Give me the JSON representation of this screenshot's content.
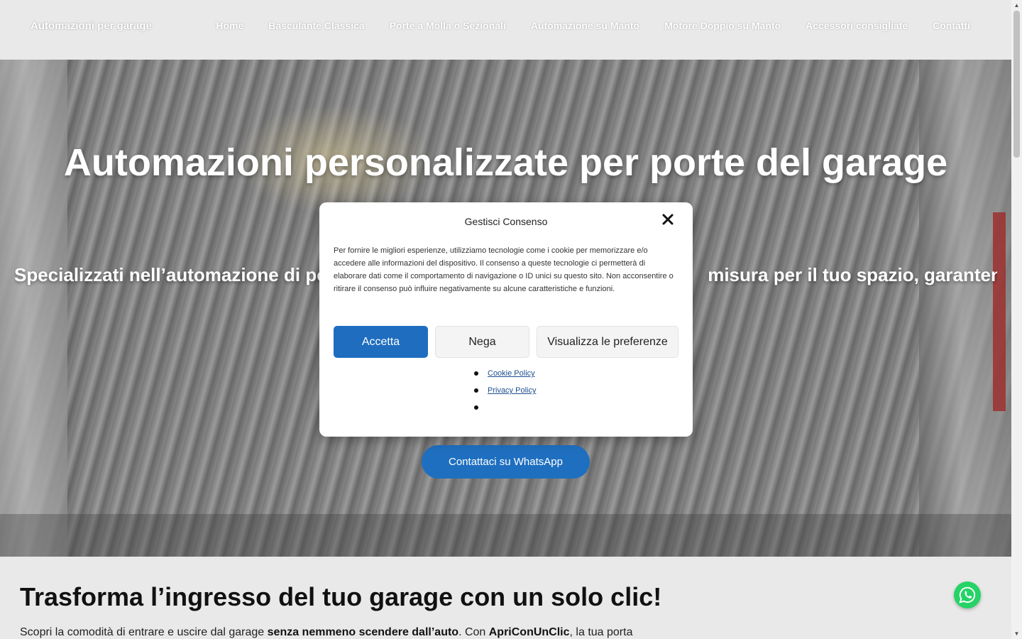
{
  "header": {
    "brand": "Automazioni per garage",
    "nav": [
      "Home",
      "Basculante Classica",
      "Porte a Molla o Sezionali",
      "Automazione su Manto",
      "Motore Doppio su Manto",
      "Accessori consigliate",
      "Contatti"
    ]
  },
  "hero": {
    "title": "Automazioni personalizzate per porte del garage",
    "subtitle_left": "Specializzati nell’automazione di por",
    "subtitle_right": "misura per il tuo spazio, garantendo",
    "cta_label": "Contattaci su WhatsApp"
  },
  "section": {
    "title": "Trasforma l’ingresso del tuo garage con un solo clic!",
    "text_1": "Scopri la comodità di entrare e uscire dal garage ",
    "text_bold_1": "senza nemmeno scendere dall’auto",
    "text_2": ". Con ",
    "text_bold_2": "ApriConUnClic",
    "text_3": ", la tua porta"
  },
  "consent": {
    "title": "Gestisci Consenso",
    "body": "Per fornire le migliori esperienze, utilizziamo tecnologie come i cookie per memorizzare e/o accedere alle informazioni del dispositivo. Il consenso a queste tecnologie ci permetterà di elaborare dati come il comportamento di navigazione o ID unici su questo sito. Non acconsentire o ritirare il consenso può influire negativamente su alcune caratteristiche e funzioni.",
    "accept": "Accetta",
    "deny": "Nega",
    "preferences": "Visualizza le preferenze",
    "links": [
      "Cookie Policy",
      "Privacy Policy",
      ""
    ]
  },
  "colors": {
    "primary_blue": "#1e6dbf",
    "whatsapp_green": "#25d366"
  },
  "icons": {
    "close": "close-icon",
    "whatsapp": "whatsapp-icon"
  }
}
